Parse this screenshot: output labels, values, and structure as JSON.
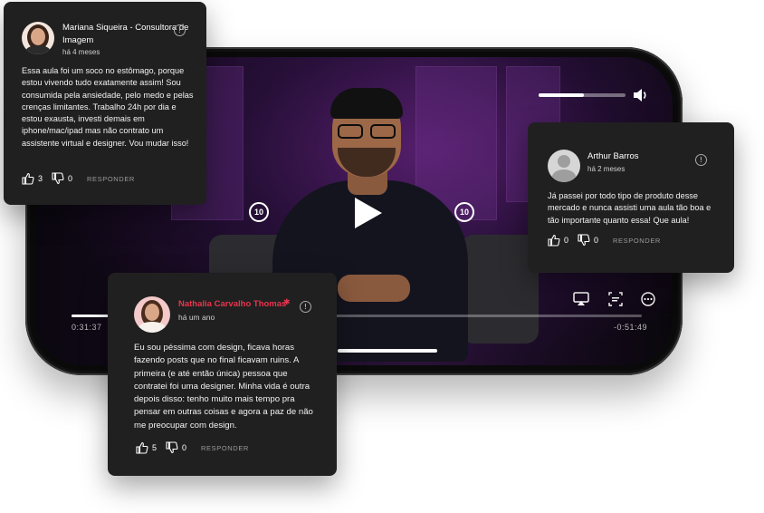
{
  "player": {
    "elapsed": "0:31:37",
    "remaining": "-0:51:49",
    "skip_back_label": "10",
    "skip_forward_label": "10",
    "progress_fraction": 0.07,
    "volume_fraction": 0.52
  },
  "comments": [
    {
      "author": "Mariana Siqueira - Consultora de Imagem",
      "time": "há 4 meses",
      "text": "Essa aula foi um soco no estômago, porque estou vivendo tudo exatamente assim! Sou consumida pela ansiedade, pelo medo e pelas crenças limitantes. Trabalho 24h por dia e estou exausta, investi demais em iphone/mac/ipad mas não contrato um assistente virtual e designer. Vou mudar isso!",
      "likes": "3",
      "dislikes": "0",
      "reply_label": "RESPONDER"
    },
    {
      "author": "Arthur Barros",
      "time": "há 2 meses",
      "text": "Já passei por todo tipo de produto desse mercado e nunca assisti uma aula tão boa e tão importante quanto essa! Que aula!",
      "likes": "0",
      "dislikes": "0",
      "reply_label": "RESPONDER"
    },
    {
      "author": "Nathalia Carvalho Thomas",
      "author_color": "#e8354d",
      "time": "há um ano",
      "text": "Eu sou péssima com design, ficava horas fazendo posts que no final ficavam ruins. A primeira (e até então única) pessoa que contratei foi uma designer. Minha vida é outra depois disso: tenho muito mais tempo pra pensar em outras coisas e agora a paz de não me preocupar com design.",
      "likes": "5",
      "dislikes": "0",
      "reply_label": "RESPONDER"
    }
  ]
}
